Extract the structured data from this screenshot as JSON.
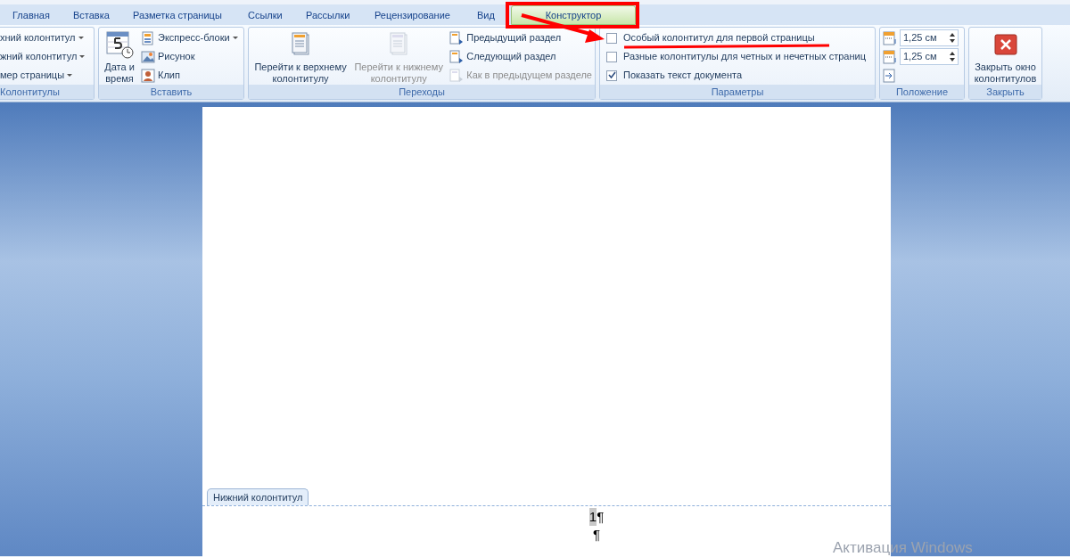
{
  "tabs": [
    {
      "label": "Главная",
      "selected": false
    },
    {
      "label": "Вставка",
      "selected": false
    },
    {
      "label": "Разметка страницы",
      "selected": false
    },
    {
      "label": "Ссылки",
      "selected": false
    },
    {
      "label": "Рассылки",
      "selected": false
    },
    {
      "label": "Рецензирование",
      "selected": false
    },
    {
      "label": "Вид",
      "selected": false
    },
    {
      "label": "Конструктор",
      "selected": true
    }
  ],
  "header_footer_group": {
    "label": "Колонтитулы",
    "items": [
      {
        "label": "хний колонтитул"
      },
      {
        "label": "жний колонтитул"
      },
      {
        "label": "мер страницы"
      }
    ]
  },
  "insert_group": {
    "label": "Вставить",
    "large_button": "Дата и время",
    "items": [
      {
        "label": "Экспресс-блоки",
        "dropdown": true
      },
      {
        "label": "Рисунок",
        "dropdown": false
      },
      {
        "label": "Клип",
        "dropdown": false
      }
    ]
  },
  "navigation_group": {
    "label": "Переходы",
    "large_buttons": [
      {
        "label": "Перейти к верхнему колонтитулу",
        "disabled": false
      },
      {
        "label": "Перейти к нижнему колонтитулу",
        "disabled": true
      }
    ],
    "items": [
      {
        "label": "Предыдущий раздел",
        "disabled": false
      },
      {
        "label": "Следующий раздел",
        "disabled": false
      },
      {
        "label": "Как в предыдущем разделе",
        "disabled": true
      }
    ]
  },
  "options_group": {
    "label": "Параметры",
    "options": [
      {
        "label": "Особый колонтитул для первой страницы",
        "checked": false
      },
      {
        "label": "Разные колонтитулы для четных и нечетных страниц",
        "checked": false
      },
      {
        "label": "Показать текст документа",
        "checked": true
      }
    ]
  },
  "position_group": {
    "label": "Положение",
    "spinners": [
      {
        "value": "1,25 см"
      },
      {
        "value": "1,25 см"
      }
    ]
  },
  "close_group": {
    "label": "Закрыть",
    "button": "Закрыть окно колонтитулов"
  },
  "document": {
    "footer_tab": "Нижний колонтитул",
    "footer_lines": [
      {
        "field": "1",
        "text": "¶"
      },
      {
        "text": "¶"
      }
    ]
  },
  "os_notice": "Активация Windows"
}
